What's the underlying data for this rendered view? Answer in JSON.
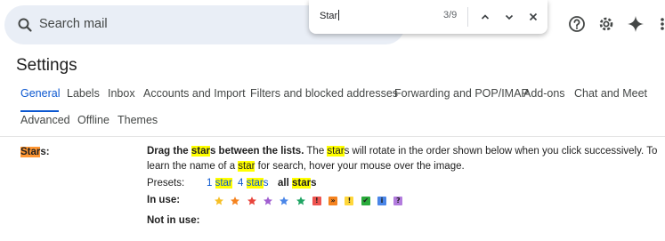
{
  "search": {
    "placeholder": "Search mail",
    "icon": "search-icon"
  },
  "header_icons": [
    {
      "name": "help-icon"
    },
    {
      "name": "settings-icon"
    },
    {
      "name": "gemini-sparkle-icon"
    },
    {
      "name": "apps-grid-icon"
    }
  ],
  "find_bar": {
    "query": "Star",
    "count": "3/9",
    "prev_icon": "chevron-up-icon",
    "next_icon": "chevron-down-icon",
    "close_icon": "close-icon"
  },
  "page": {
    "title": "Settings"
  },
  "tabs": [
    {
      "label": "General",
      "active": true
    },
    {
      "label": "Labels"
    },
    {
      "label": "Inbox"
    },
    {
      "label": "Accounts and Import"
    },
    {
      "label": "Filters and blocked addresses"
    },
    {
      "label": "Forwarding and POP/IMAP"
    },
    {
      "label": "Add-ons"
    },
    {
      "label": "Chat and Meet"
    },
    {
      "label": "Advanced"
    },
    {
      "label": "Offline"
    },
    {
      "label": "Themes"
    }
  ],
  "stars": {
    "label": "Stars:",
    "description": "Drag the stars between the lists.  The stars will rotate in the order shown below when you click successively. To learn the name of a star for search, hover your mouse over the image.",
    "presets_label": "Presets:",
    "presets": [
      "1 star",
      "4 stars",
      "all stars"
    ],
    "in_use_label": "In use:",
    "not_in_use_label": "Not in use:",
    "in_use": [
      {
        "name": "yellow-star-icon",
        "color": "#f6bf26"
      },
      {
        "name": "orange-star-icon",
        "color": "#f5831f"
      },
      {
        "name": "red-star-icon",
        "color": "#e8453c"
      },
      {
        "name": "purple-star-icon",
        "color": "#a05ed0"
      },
      {
        "name": "blue-star-icon",
        "color": "#4a86e8"
      },
      {
        "name": "green-star-icon",
        "color": "#1fa463"
      },
      {
        "name": "red-bang-icon",
        "color": "#ee5450",
        "glyph": "!"
      },
      {
        "name": "orange-guillemet-icon",
        "color": "#f5831f",
        "glyph": "»"
      },
      {
        "name": "yellow-bang-icon",
        "color": "#ffd73a",
        "glyph": "!"
      },
      {
        "name": "green-check-icon",
        "color": "#2aab3c",
        "glyph": "✔"
      },
      {
        "name": "blue-info-icon",
        "color": "#4a86e8",
        "glyph": "i"
      },
      {
        "name": "purple-question-icon",
        "color": "#b37cde",
        "glyph": "?"
      }
    ]
  }
}
